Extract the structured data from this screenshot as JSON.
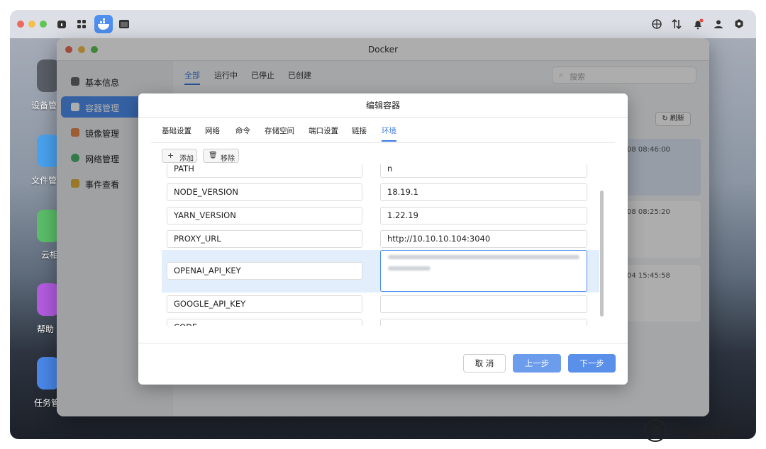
{
  "window": {
    "title": "Docker"
  },
  "desktop": {
    "apps": [
      "设备管",
      "文件管",
      "云相",
      "帮助",
      "任务管"
    ]
  },
  "sidebar": {
    "items": [
      {
        "label": "基本信息",
        "icon": "info-icon",
        "active": false
      },
      {
        "label": "容器管理",
        "icon": "docker-icon",
        "active": true
      },
      {
        "label": "镜像管理",
        "icon": "image-icon",
        "active": false
      },
      {
        "label": "网络管理",
        "icon": "globe-icon",
        "active": false
      },
      {
        "label": "事件查看",
        "icon": "calendar-icon",
        "active": false
      }
    ]
  },
  "content": {
    "tabs": [
      "全部",
      "运行中",
      "已停止",
      "已创建"
    ],
    "search_placeholder": "搜索",
    "refresh_label": "刷新",
    "cards": [
      "08 08:46:00",
      "08 08:25:20",
      "04 15:45:58"
    ]
  },
  "dialog": {
    "title": "编辑容器",
    "tabs": [
      "基础设置",
      "网络",
      "命令",
      "存储空间",
      "端口设置",
      "链接",
      "环境"
    ],
    "active_tab": "环境",
    "add_label": "添加",
    "remove_label": "移除",
    "env": [
      {
        "key": "PATH",
        "value": "n"
      },
      {
        "key": "NODE_VERSION",
        "value": "18.19.1"
      },
      {
        "key": "YARN_VERSION",
        "value": "1.22.19"
      },
      {
        "key": "PROXY_URL",
        "value": "http://10.10.10.104:3040"
      },
      {
        "key": "OPENAI_API_KEY",
        "value": ""
      },
      {
        "key": "GOOGLE_API_KEY",
        "value": ""
      },
      {
        "key": "CODE",
        "value": ""
      }
    ],
    "buttons": {
      "cancel": "取 消",
      "prev": "上一步",
      "next": "下一步"
    }
  },
  "watermark": {
    "logo": "值",
    "text": "什么值得买"
  },
  "colors": {
    "accent": "#3a7ae0",
    "primary_button": "#5a8fea",
    "selected_row": "#e3eefc"
  }
}
